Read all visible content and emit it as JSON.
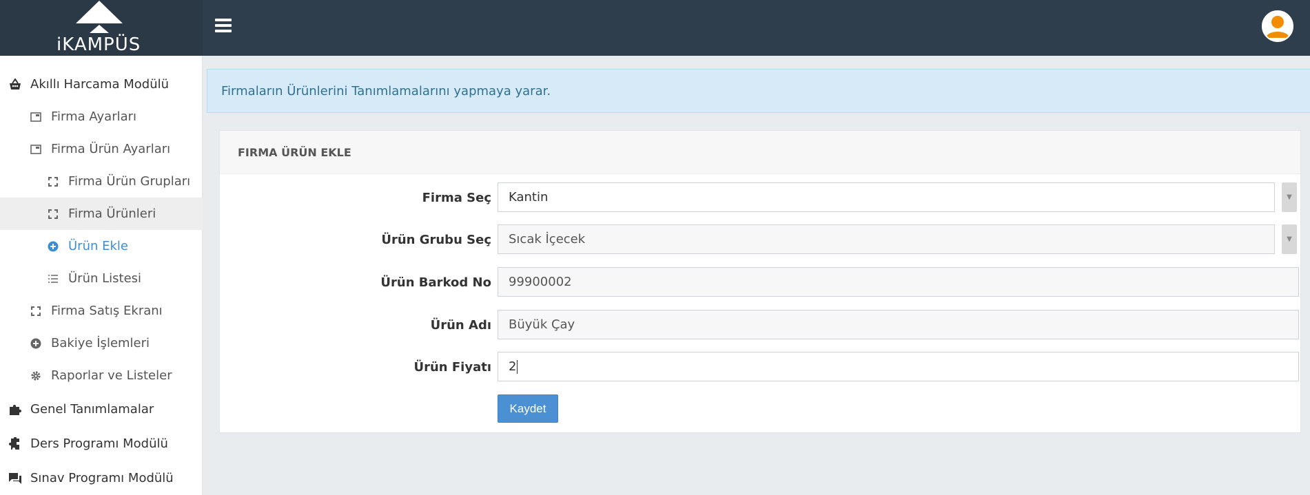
{
  "app": {
    "logo_text": "iKAMPÜS"
  },
  "sidebar": {
    "items": [
      {
        "label": "Akıllı Harcama Modülü",
        "icon": "basket-icon"
      },
      {
        "label": "Firma Ayarları",
        "icon": "window-icon"
      },
      {
        "label": "Firma Ürün Ayarları",
        "icon": "window-icon"
      },
      {
        "label": "Firma Ürün Grupları",
        "icon": "expand-icon"
      },
      {
        "label": "Firma Ürünleri",
        "icon": "expand-icon"
      },
      {
        "label": "Ürün Ekle",
        "icon": "plus-circle-icon"
      },
      {
        "label": "Ürün Listesi",
        "icon": "list-icon"
      },
      {
        "label": "Firma Satış Ekranı",
        "icon": "expand-icon"
      },
      {
        "label": "Bakiye İşlemleri",
        "icon": "plus-circle-icon"
      },
      {
        "label": "Raporlar ve Listeler",
        "icon": "gear-icon"
      },
      {
        "label": "Genel Tanımlamalar",
        "icon": "puzzle-icon"
      },
      {
        "label": "Ders Programı Modülü",
        "icon": "puzzle-icon"
      },
      {
        "label": "Sınav Programı Modülü",
        "icon": "chat-icon"
      }
    ]
  },
  "info": {
    "text": "Firmaların Ürünlerini Tanımlamalarını yapmaya yarar."
  },
  "panel": {
    "title": "FIRMA ÜRÜN EKLE",
    "fields": {
      "firma": {
        "label": "Firma Seç",
        "value": "Kantin"
      },
      "grup": {
        "label": "Ürün Grubu Seç",
        "value": "Sıcak İçecek"
      },
      "barkod": {
        "label": "Ürün Barkod No",
        "value": "99900002"
      },
      "ad": {
        "label": "Ürün Adı",
        "value": "Büyük Çay"
      },
      "fiyat": {
        "label": "Ürün Fiyatı",
        "value": "2"
      }
    },
    "save_label": "Kaydet"
  },
  "colors": {
    "topbar": "#2f3e4c",
    "accent": "#4a90d2",
    "info_bg": "#d6eaf8",
    "avatar": "#f28c00"
  }
}
